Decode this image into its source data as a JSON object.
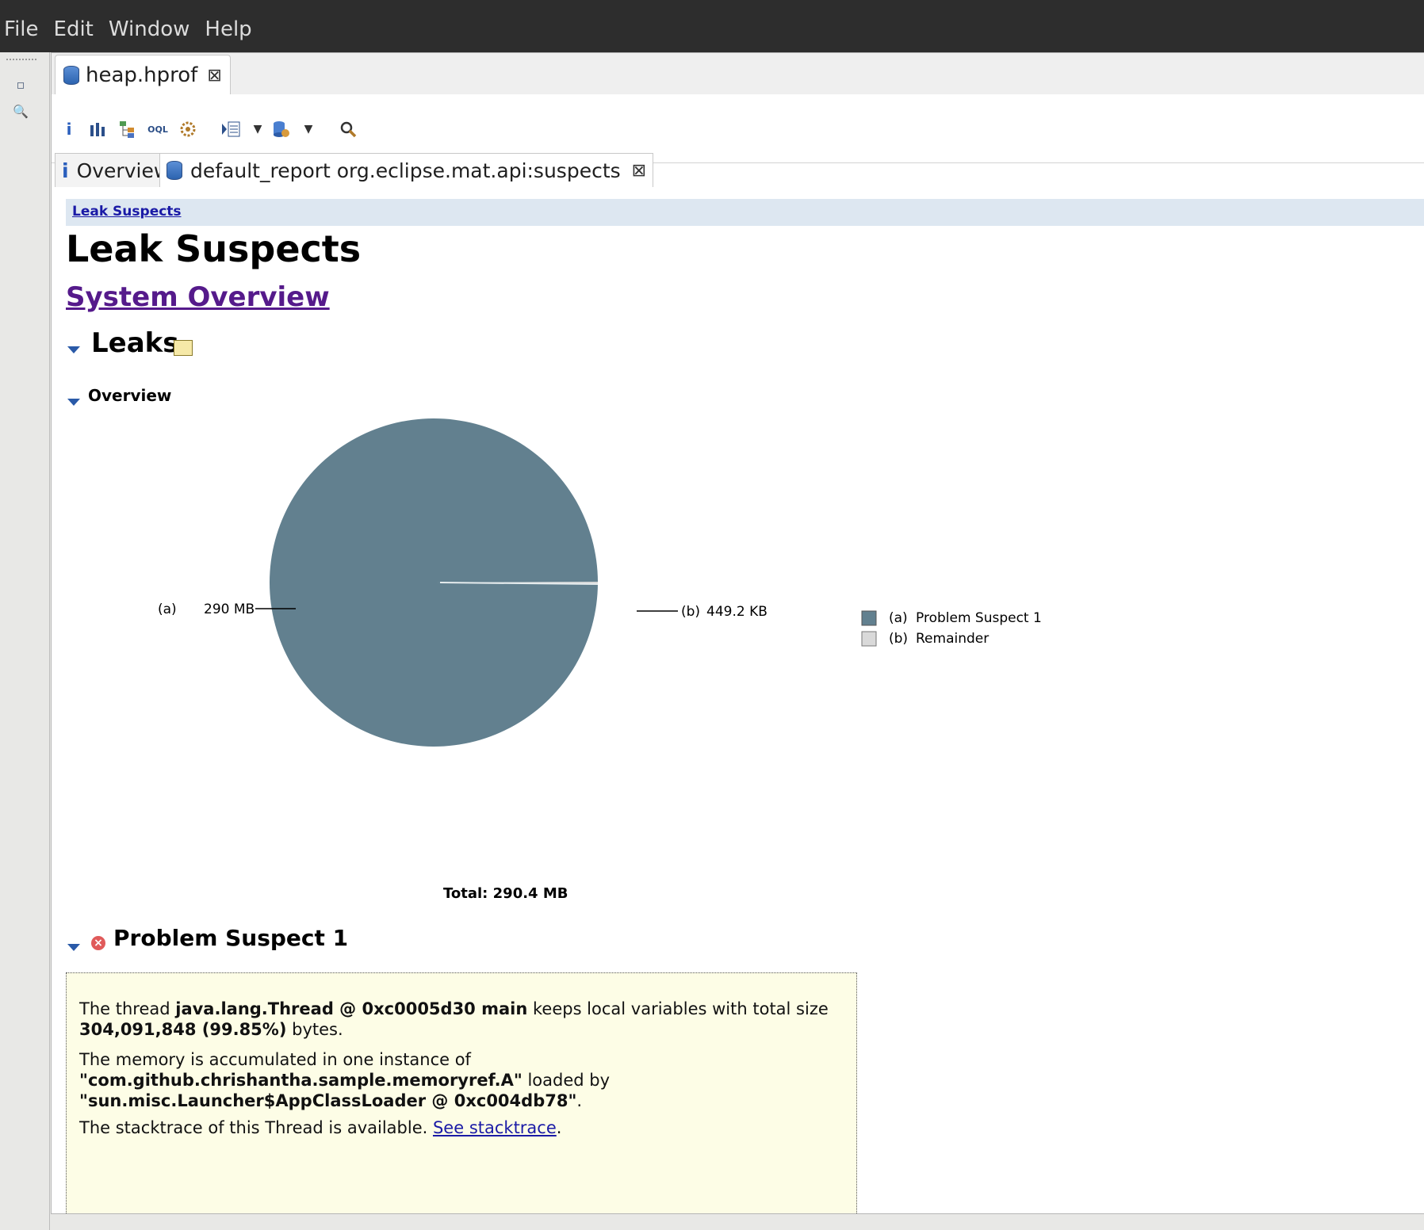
{
  "menu": {
    "file": "File",
    "edit": "Edit",
    "window": "Window",
    "help": "Help"
  },
  "editor_tab": {
    "label": "heap.hprof",
    "close": "⊠"
  },
  "subtabs": {
    "overview": {
      "icon": "i",
      "label": "Overview"
    },
    "report": {
      "label": "default_report  org.eclipse.mat.api:suspects",
      "close": "⊠"
    }
  },
  "toolbar": {
    "info": "i",
    "histogram": "histogram-icon",
    "dominator": "dominator-tree-icon",
    "oql": "OQL",
    "threads": "thread-overview-icon",
    "query": "query-browser-icon",
    "reports": "reports-icon",
    "search": "search-icon"
  },
  "page": {
    "breadcrumb": "Leak Suspects",
    "title": "Leak Suspects",
    "system_overview": "System Overview",
    "leaks": "Leaks",
    "overview": "Overview",
    "total": "Total: 290.4 MB",
    "problem_suspect": "Problem Suspect 1"
  },
  "chart_data": {
    "type": "pie",
    "slices": [
      {
        "id": "(a)",
        "name": "Problem Suspect 1",
        "label": "290 MB",
        "value_mb": 290.0,
        "color": "#62808f"
      },
      {
        "id": "(b)",
        "name": "Remainder",
        "label": "449.2 KB",
        "value_mb": 0.4387,
        "color": "#d9d9d9"
      }
    ],
    "total": "Total: 290.4 MB",
    "legend_placement": "right"
  },
  "suspect_text": {
    "p1_a": "The thread ",
    "p1_b": "java.lang.Thread @ 0xc0005d30 main",
    "p1_c": " keeps local variables with total size ",
    "p1_d": "304,091,848 (99.85%)",
    "p1_e": " bytes.",
    "p2_a": "The memory is accumulated in one instance of",
    "p2_b": "\"com.github.chrishantha.sample.memoryref.A\"",
    "p2_c": " loaded by",
    "p2_d": "\"sun.misc.Launcher$AppClassLoader @ 0xc004db78\"",
    "p2_e": ".",
    "p3_a": "The stacktrace of this Thread is available. ",
    "p3_link": "See stacktrace",
    "p3_b": "."
  }
}
